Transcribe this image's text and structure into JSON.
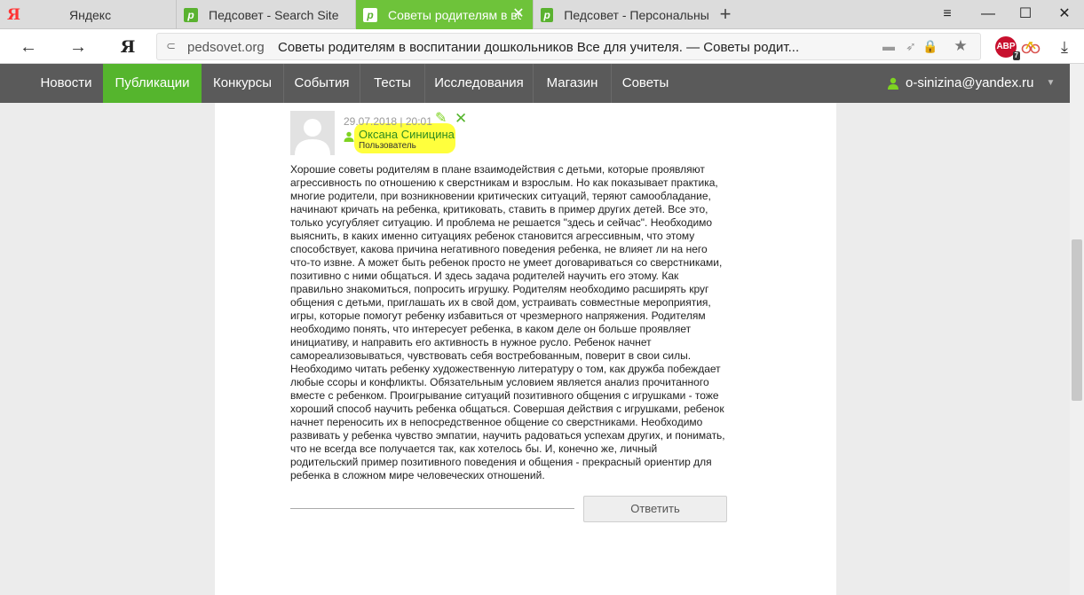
{
  "tabs": [
    {
      "label": "Яндекс",
      "favicon": "yandex-icon"
    },
    {
      "label": "Педсовет - Search Site",
      "favicon": "pedsovet-icon"
    },
    {
      "label": "Советы родителям в вос",
      "favicon": "pedsovet-icon",
      "active": true
    },
    {
      "label": "Педсовет - Персональный с",
      "favicon": "pedsovet-icon"
    }
  ],
  "window_controls": {
    "menu": "≡",
    "minimize": "—",
    "maximize": "☐",
    "close": "✕"
  },
  "address_bar": {
    "domain": "pedsovet.org",
    "title": "Советы родителям в воспитании дошкольников Все для учителя. — Советы родит..."
  },
  "yandex_button": "Я",
  "site_nav": {
    "items": [
      "Новости",
      "Публикации",
      "Конкурсы",
      "События",
      "Тесты",
      "Исследования",
      "Магазин",
      "Советы"
    ],
    "active_index": 1,
    "user_email": "o-sinizina@yandex.ru"
  },
  "comment": {
    "date": "29.07.2018 | 20:01",
    "author": "Оксана Синицина",
    "role": "Пользователь",
    "lines": [
      "Хорошие советы родителям в плане взаимодействия с детьми, которые проявляют",
      "агрессивность по отношению к сверстникам и взрослым. Но как показывает практика,",
      "многие родители, при возникновении критических ситуаций, теряют самообладание,",
      "начинают кричать на ребенка, критиковать, ставить в пример других детей. Все это,",
      "только усугубляет ситуацию. И проблема не решается \"здесь и сейчас\". Необходимо",
      "выяснить, в каких именно ситуациях ребенок становится агрессивным, что этому",
      "способствует, какова причина негативного поведения ребенка, не влияет ли на него",
      "что-то извне. А может быть ребенок просто не умеет договариваться со сверстниками,",
      "позитивно с ними общаться. И здесь задача родителей научить его этому. Как",
      "правильно знакомиться, попросить игрушку. Родителям необходимо расширять круг",
      "общения с детьми, приглашать их в свой дом, устраивать совместные мероприятия,",
      "игры, которые помогут ребенку избавиться от чрезмерного напряжения. Родителям",
      "необходимо понять, что интересует ребенка, в каком деле он больше проявляет",
      "инициативу, и направить его активность в нужное русло. Ребенок начнет",
      "самореализовываться, чувствовать себя востребованным, поверит в свои силы.",
      "Необходимо читать ребенку художественную литературу о том, как дружба побеждает",
      "любые ссоры и конфликты. Обязательным условием является анализ прочитанного",
      "вместе с ребенком. Проигрывание ситуаций позитивного общения с игрушками - тоже",
      "хороший способ научить ребенка общаться. Совершая действия с игрушками, ребенок",
      "начнет переносить их в непосредственное общение со сверстниками. Необходимо",
      "развивать у ребенка чувство эмпатии, научить радоваться успехам других, и понимать,",
      "что не всегда все получается так, как хотелось бы. И, конечно же, личный",
      "родительский пример позитивного поведения и общения - прекрасный ориентир для",
      "ребенка в сложном мире человеческих отношений."
    ],
    "reply_label": "Ответить"
  },
  "extensions": {
    "adblock_label": "ABP",
    "adblock_count": "7"
  },
  "colors": {
    "brand_green": "#55b52d",
    "nav_bg": "#5a5a5a",
    "highlight": "#ffff3d",
    "tab_active": "#6ec33a"
  }
}
